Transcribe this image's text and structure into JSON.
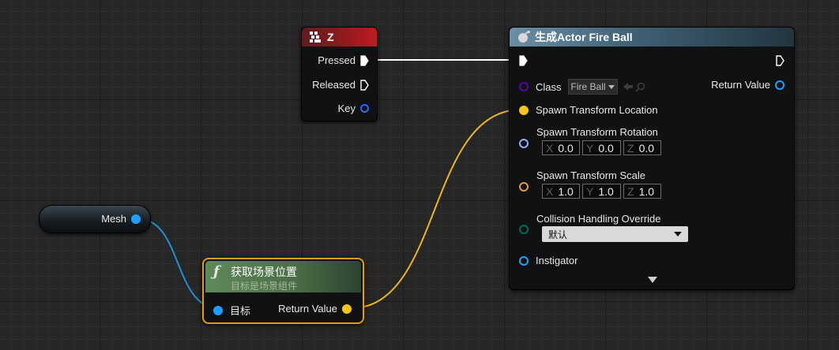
{
  "key_node": {
    "title": "Z",
    "pins": {
      "pressed": "Pressed",
      "released": "Released",
      "key": "Key"
    }
  },
  "spawn_node": {
    "title": "生成Actor Fire Ball",
    "class_label": "Class",
    "class_value": "Fire Ball",
    "return_value": "Return Value",
    "location": "Spawn Transform Location",
    "rotation": {
      "label": "Spawn Transform Rotation",
      "x": "0.0",
      "y": "0.0",
      "z": "0.0"
    },
    "scale": {
      "label": "Spawn Transform Scale",
      "x": "1.0",
      "y": "1.0",
      "z": "1.0"
    },
    "collision": {
      "label": "Collision Handling Override",
      "value": "默认"
    },
    "instigator": "Instigator"
  },
  "axis_labels": {
    "x": "X",
    "y": "Y",
    "z": "Z"
  },
  "mesh_node": {
    "label": "Mesh"
  },
  "func_node": {
    "title": "获取场景位置",
    "subtitle": "目标是场景组件",
    "target": "目标",
    "return_value": "Return Value"
  },
  "colors": {
    "object_pin": "#1ea0ff",
    "vector_pin": "#f5c518",
    "rotator_pin": "#99aaff",
    "transform_pin": "#e89a2a",
    "enum_pin": "#00695c",
    "class_pin": "#5a00aa",
    "key_pin": "#2a66ff",
    "select_border": "#e59a12"
  }
}
